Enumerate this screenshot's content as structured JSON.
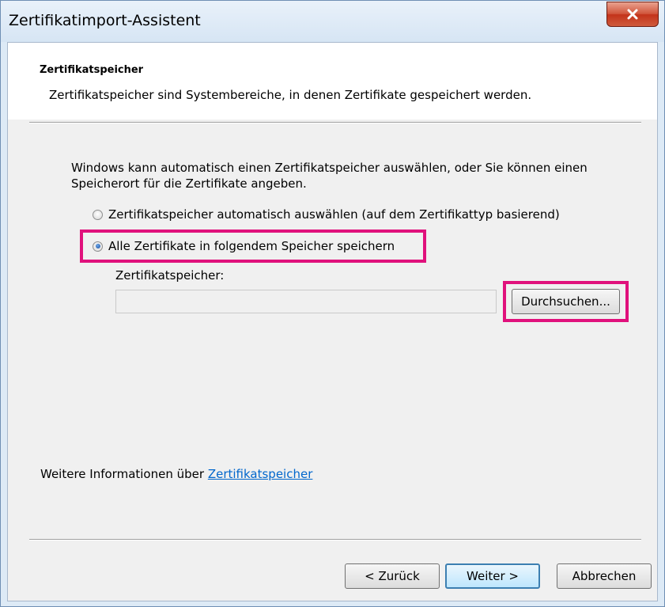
{
  "window": {
    "title": "Zertifikatimport-Assistent"
  },
  "header": {
    "title": "Zertifikatspeicher",
    "description": "Zertifikatspeicher sind Systembereiche, in denen Zertifikate gespeichert werden."
  },
  "body": {
    "intro": "Windows kann automatisch einen Zertifikatspeicher auswählen, oder Sie können einen Speicherort für die Zertifikate angeben.",
    "options": [
      {
        "label": "Zertifikatspeicher automatisch auswählen (auf dem Zertifikattyp basierend)",
        "selected": false
      },
      {
        "label": "Alle Zertifikate in folgendem Speicher speichern",
        "selected": true
      }
    ],
    "store_label": "Zertifikatspeicher:",
    "store_value": "",
    "browse_label": "Durchsuchen..."
  },
  "info": {
    "prefix": "Weitere Informationen über ",
    "link": "Zertifikatspeicher"
  },
  "buttons": {
    "back": "< Zurück",
    "next": "Weiter >",
    "cancel": "Abbrechen"
  },
  "colors": {
    "highlight": "#e0117c",
    "link": "#0066cc",
    "close_button": "#c3331a"
  }
}
